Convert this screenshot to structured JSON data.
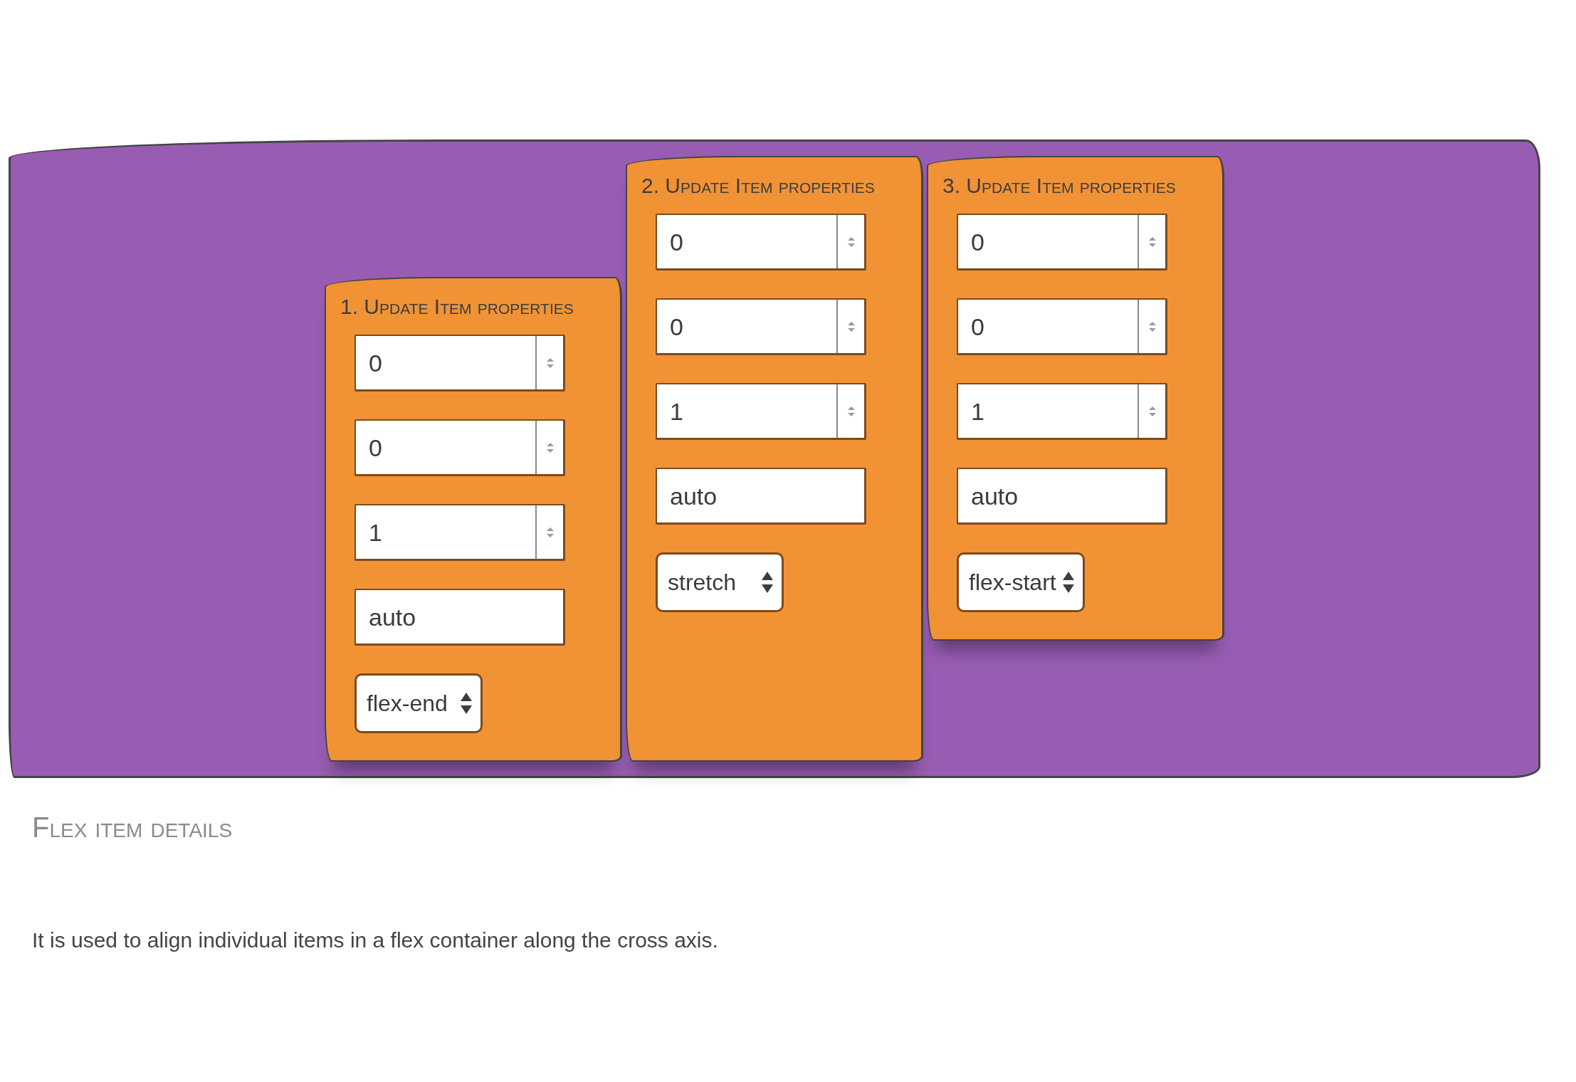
{
  "container": {
    "items": [
      {
        "title": "1. Update Item properties",
        "kind": "end",
        "fields": [
          {
            "kind": "number",
            "value": "0"
          },
          {
            "kind": "number",
            "value": "0"
          },
          {
            "kind": "number",
            "value": "1"
          },
          {
            "kind": "text",
            "value": "auto"
          },
          {
            "kind": "select",
            "value": "flex-end"
          }
        ]
      },
      {
        "title": "2. Update Item properties",
        "kind": "stretch",
        "fields": [
          {
            "kind": "number",
            "value": "0"
          },
          {
            "kind": "number",
            "value": "0"
          },
          {
            "kind": "number",
            "value": "1"
          },
          {
            "kind": "text",
            "value": "auto"
          },
          {
            "kind": "select",
            "value": "stretch"
          }
        ]
      },
      {
        "title": "3. Update Item properties",
        "kind": "start",
        "fields": [
          {
            "kind": "number",
            "value": "0"
          },
          {
            "kind": "number",
            "value": "0"
          },
          {
            "kind": "number",
            "value": "1"
          },
          {
            "kind": "text",
            "value": "auto"
          },
          {
            "kind": "select",
            "value": "flex-start"
          }
        ]
      }
    ]
  },
  "section": {
    "heading": "Flex item details",
    "description": "It is used to align individual items in a flex container along the cross axis."
  }
}
